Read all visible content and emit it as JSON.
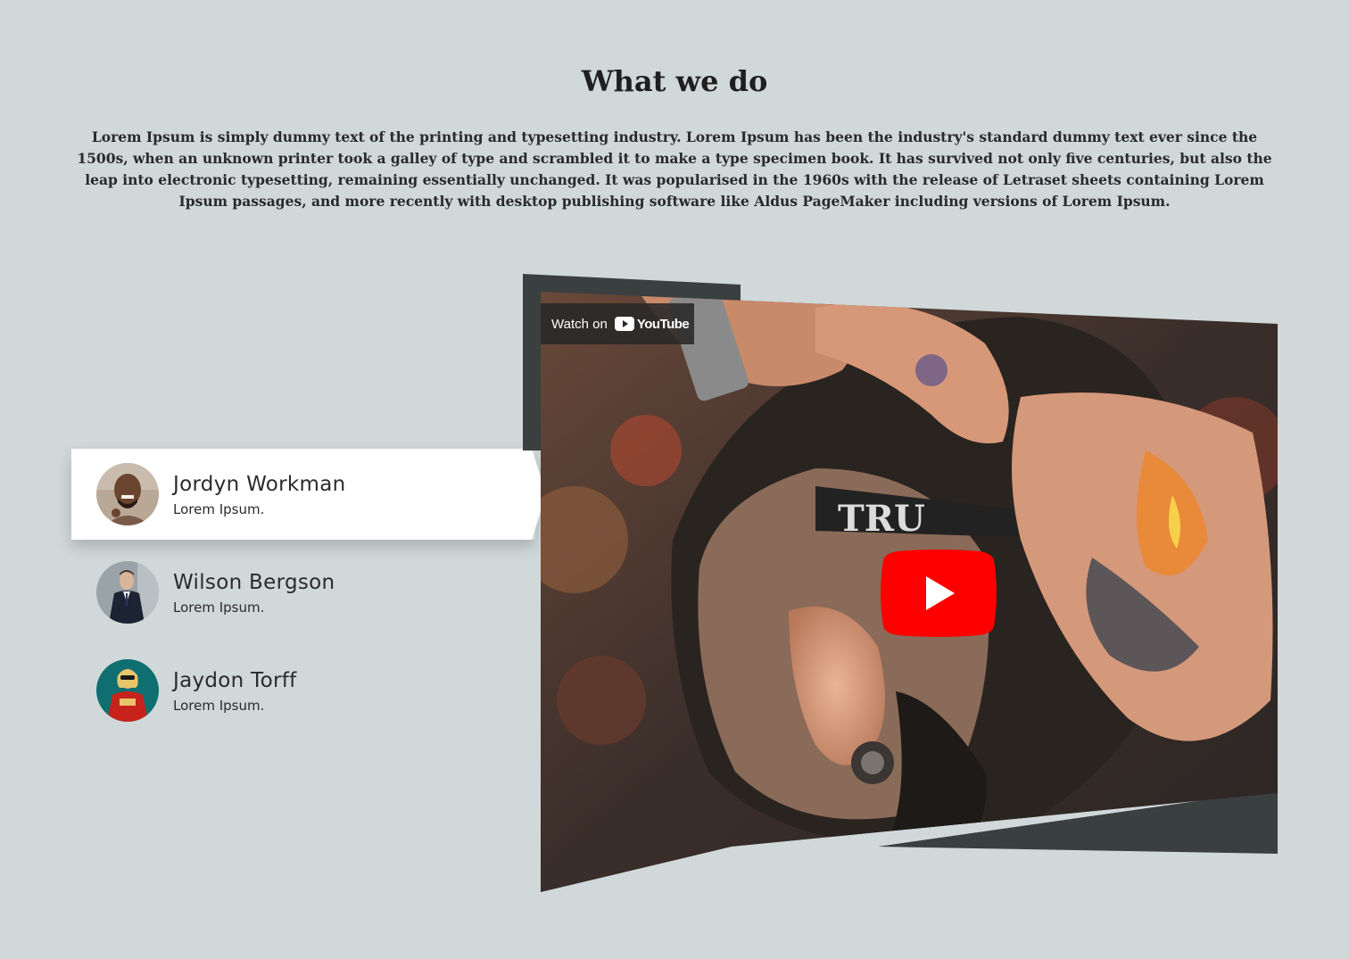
{
  "section": {
    "title": "What we do",
    "intro": "Lorem Ipsum is simply dummy text of the printing and typesetting industry. Lorem Ipsum has been the industry's standard dummy text ever since the 1500s, when an unknown printer took a galley of type and scrambled it to make a type specimen book. It has survived not only five centuries, but also the leap into electronic typesetting, remaining essentially unchanged. It was popularised in the 1960s with the release of Letraset sheets containing Lorem Ipsum passages, and more recently with desktop publishing software like Aldus PageMaker including versions of Lorem Ipsum."
  },
  "people": [
    {
      "name": "Jordyn Workman",
      "role": "Lorem Ipsum.",
      "active": true
    },
    {
      "name": "Wilson Bergson",
      "role": "Lorem Ipsum.",
      "active": false
    },
    {
      "name": "Jaydon Torff",
      "role": "Lorem Ipsum.",
      "active": false
    }
  ],
  "video": {
    "watch_on_label": "Watch on",
    "youtube_label": "YouTube",
    "razor_text": "TRU",
    "play_icon": "youtube-play-icon"
  },
  "colors": {
    "background": "#d0d8d9",
    "video_frame": "#3a3f40",
    "youtube_red": "#ff0000"
  }
}
